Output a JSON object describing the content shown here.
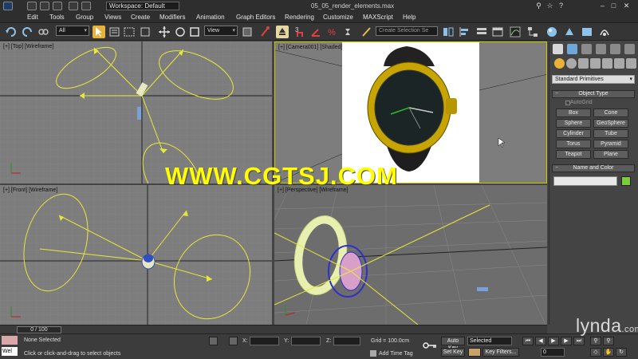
{
  "window": {
    "title": "05_05_render_elements.max",
    "workspace_label": "Workspace: Default"
  },
  "menu": {
    "items": [
      "Edit",
      "Tools",
      "Group",
      "Views",
      "Create",
      "Modifiers",
      "Animation",
      "Graph Editors",
      "Rendering",
      "Customize",
      "MAXScript",
      "Help"
    ]
  },
  "toolbar": {
    "selection_filter": "All",
    "ref_coord": "View",
    "named_selection_placeholder": "Create Selection Se",
    "snap_label": "3",
    "icons": [
      "undo-icon",
      "redo-icon",
      "link-icon",
      "unlink-icon",
      "bind-space-warp-icon",
      "select-object-icon",
      "select-by-name-icon",
      "rectangle-region-icon",
      "window-crossing-icon",
      "move-icon",
      "rotate-icon",
      "scale-icon",
      "pivot-icon",
      "select-manipulate-icon",
      "keyboard-shortcut-icon",
      "snap-toggle-icon",
      "angle-snap-icon",
      "percent-snap-icon",
      "spinner-snap-icon",
      "edit-named-selection-icon",
      "mirror-icon",
      "align-icon",
      "layer-manager-icon",
      "graphite-ribbon-icon",
      "curve-editor-icon",
      "schematic-view-icon",
      "material-editor-icon",
      "render-setup-icon",
      "rendered-frame-icon",
      "render-icon"
    ]
  },
  "viewports": {
    "top": "[+] [Top] [Wireframe]",
    "camera": "[+] [Camera001] [Shaded]",
    "front": "[+] [Front] [Wireframe]",
    "perspective": "[+] [Perspective] [Wireframe]"
  },
  "watermark": "WWW.CGTSJ.COM",
  "command_panel": {
    "tab_icons": [
      "create-tab-icon",
      "modify-tab-icon",
      "hierarchy-tab-icon",
      "motion-tab-icon",
      "display-tab-icon",
      "utilities-tab-icon"
    ],
    "category_icons": [
      "geometry-icon",
      "shapes-icon",
      "lights-icon",
      "cameras-icon",
      "helpers-icon",
      "space-warps-icon",
      "systems-icon"
    ],
    "primitive_type": "Standard Primitives",
    "object_type_header": "Object Type",
    "autogrid": "AutoGrid",
    "buttons": [
      "Box",
      "Cone",
      "Sphere",
      "GeoSphere",
      "Cylinder",
      "Tube",
      "Torus",
      "Pyramid",
      "Teapot",
      "Plane"
    ],
    "name_color_header": "Name and Color"
  },
  "timeline": {
    "frame_counter": "0 / 100"
  },
  "statusbar": {
    "script_listener": "Wel",
    "selection_status": "None Selected",
    "prompt": "Click or click-and-drag to select objects",
    "x_label": "X:",
    "y_label": "Y:",
    "z_label": "Z:",
    "grid": "Grid = 100.0cm",
    "add_time_tag": "Add Time Tag",
    "auto_key": "Auto Key",
    "set_key": "Set Key",
    "selected": "Selected",
    "key_filters": "Key Filters...",
    "frame": "0"
  },
  "branding": {
    "logo_text": "lynda",
    "logo_suffix": ".com"
  },
  "colors": {
    "viewport_bg": "#7d7d7d",
    "active_border": "#c8c800",
    "watermark": "#ffff00",
    "helper_yellow": "#e8e83a",
    "watch_gold": "#c8a400"
  }
}
